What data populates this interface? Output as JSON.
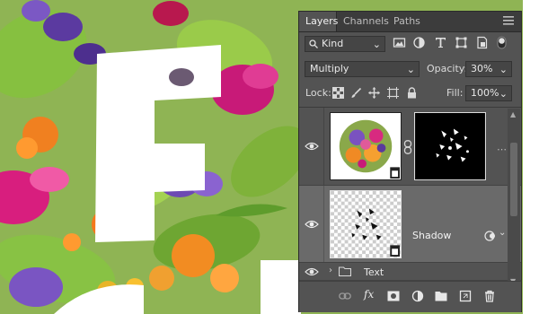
{
  "panel": {
    "tabs": [
      {
        "label": "Layers",
        "active": true
      },
      {
        "label": "Channels",
        "active": false
      },
      {
        "label": "Paths",
        "active": false
      }
    ],
    "filter": {
      "label": "Kind"
    },
    "blend_mode": "Multiply",
    "opacity": {
      "label": "Opacity:",
      "value": "30%"
    },
    "lock_label": "Lock:",
    "fill": {
      "label": "Fill:",
      "value": "100%"
    },
    "layers": [
      {
        "name": "",
        "kind": "smart-object-with-mask",
        "selected": false,
        "visible": true
      },
      {
        "name": "Shadow",
        "kind": "layer",
        "selected": true,
        "visible": true
      },
      {
        "name": "Text",
        "kind": "group",
        "selected": false,
        "visible": true
      }
    ]
  },
  "colors": {
    "panel_bg": "#535353",
    "selected_row": "#6a6a6a",
    "tab_bar": "#3c3c3c"
  },
  "icons": [
    "eye-icon",
    "chain-link-icon",
    "smart-object-badge-icon",
    "folder-icon",
    "link-layers-icon",
    "fx-icon",
    "add-mask-icon",
    "adjustment-layer-icon",
    "new-group-icon",
    "new-layer-icon",
    "trash-icon"
  ]
}
